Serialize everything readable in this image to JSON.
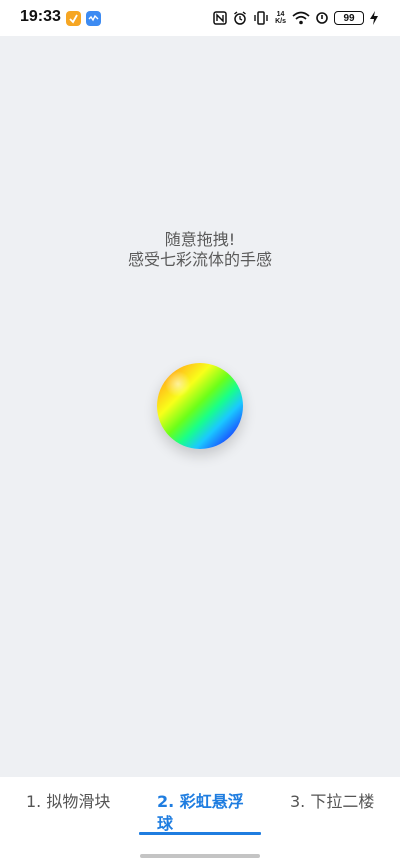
{
  "status_bar": {
    "time": "19:33",
    "net_speed_top": "14",
    "net_speed_bottom": "K/s",
    "battery": "99",
    "icons": [
      "app-orange-icon",
      "app-blue-icon",
      "nfc-icon",
      "alarm-icon",
      "vibrate-icon",
      "wifi-icon",
      "mute-icon",
      "battery-icon",
      "charging-icon"
    ]
  },
  "main": {
    "hint_line1": "随意拖拽!",
    "hint_line2": "感受七彩流体的手感",
    "ball_icon": "rainbow-ball"
  },
  "tabs": [
    {
      "label": "1. 拟物滑块",
      "selected": false
    },
    {
      "label": "2. 彩虹悬浮球",
      "selected": true
    },
    {
      "label": "3. 下拉二楼",
      "selected": false
    }
  ],
  "colors": {
    "accent": "#1f7de0",
    "background": "#eef0f3"
  }
}
